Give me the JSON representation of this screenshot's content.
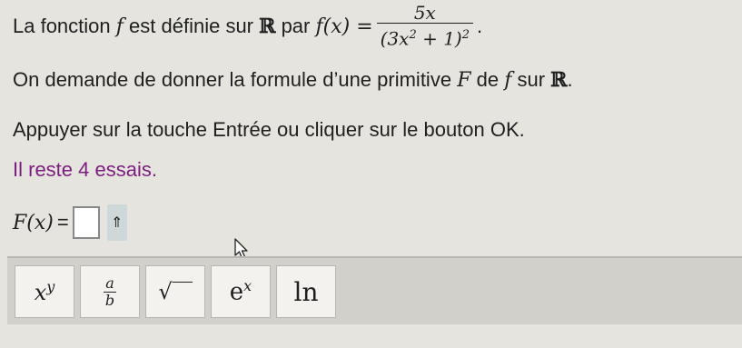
{
  "problem": {
    "intro": "La fonction",
    "f": "f",
    "middle": "est définie sur",
    "R": "ℝ",
    "par": "par",
    "fx": "f(x) =",
    "numerator": "5x",
    "denominator_base": "(3x",
    "denominator_inner_exp": "2",
    "denominator_tail": " + 1)",
    "denominator_outer_exp": "2",
    "end": "."
  },
  "question": {
    "text_a": "On demande de donner la formule d’une primitive",
    "F": "F",
    "text_b": "de",
    "f": "f",
    "text_c": "sur",
    "R": "ℝ",
    "end": "."
  },
  "instruction": "Appuyer sur la touche Entrée ou cliquer sur le bouton OK.",
  "attempts": "Il reste 4 essais.",
  "answer": {
    "label": "F(x)",
    "equals": "=",
    "value": "",
    "exponent_key": "⇑"
  },
  "toolbar": {
    "keys": [
      {
        "label": "x",
        "sup": "y",
        "icon": "power-icon"
      },
      {
        "num": "a",
        "den": "b",
        "icon": "fraction-icon"
      },
      {
        "label": "√",
        "icon": "sqrt-icon"
      },
      {
        "label": "e",
        "sup": "x",
        "icon": "exp-icon"
      },
      {
        "label": "ln",
        "icon": "ln-icon"
      }
    ]
  },
  "colors": {
    "background": "#e6e4df",
    "attempts_text": "#7b1d7e",
    "toolbar": "#d2d0ca"
  }
}
